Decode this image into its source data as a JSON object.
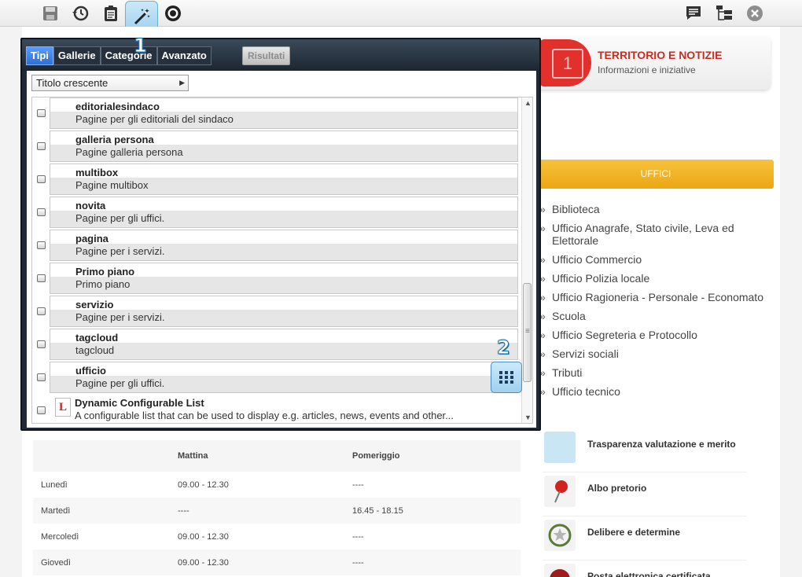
{
  "toolbar": {
    "left_icons": [
      "save-icon",
      "history-icon",
      "clipboard-icon",
      "magic-wand-icon",
      "target-icon"
    ],
    "right_icons": [
      "comment-icon",
      "tree-icon",
      "close-icon"
    ],
    "badge_1": "1",
    "badge_2": "2"
  },
  "dialog": {
    "tabs": [
      "Tipi",
      "Gallerie",
      "Categorie",
      "Avanzato"
    ],
    "active_tab": "Tipi",
    "results_label": "Risultati",
    "sort_label": "Titolo crescente",
    "items": [
      {
        "name": "editorialesindaco",
        "desc": "Pagine per gli editoriali del sindaco"
      },
      {
        "name": "galleria persona",
        "desc": "Pagine galleria persona"
      },
      {
        "name": "multibox",
        "desc": "Pagine multibox"
      },
      {
        "name": "novita",
        "desc": "Pagine per gli uffici."
      },
      {
        "name": "pagina",
        "desc": "Pagine per i servizi."
      },
      {
        "name": "Primo piano",
        "desc": "Primo piano"
      },
      {
        "name": "servizio",
        "desc": "Pagine per i servizi."
      },
      {
        "name": "tagcloud",
        "desc": "tagcloud"
      },
      {
        "name": "ufficio",
        "desc": "Pagine per gli uffici."
      },
      {
        "name": "Dynamic Configurable List",
        "desc": "A configurable list that can be used to display e.g. articles, news, events and other..."
      }
    ]
  },
  "site": {
    "promo": {
      "title": "TERRITORIO E NOTIZIE",
      "subtitle": "Informazioni e iniziative",
      "calendar_day": "1"
    },
    "uffici_title": "UFFICI",
    "uffici": [
      "Biblioteca",
      "Ufficio Anagrafe, Stato civile, Leva ed Elettorale",
      "Ufficio Commercio",
      "Ufficio Polizia locale",
      "Ufficio Ragioneria - Personale - Economato",
      "Scuola",
      "Ufficio Segreteria e Protocollo",
      "Servizi sociali",
      "Tributi",
      "Ufficio tecnico"
    ],
    "side_links": [
      "Trasparenza valutazione e merito",
      "Albo pretorio",
      "Delibere e determine",
      "Posta elettronica certificata"
    ],
    "orari": {
      "headers": [
        "",
        "Mattina",
        "Pomeriggio"
      ],
      "rows": [
        [
          "Lunedì",
          "09.00 - 12.30",
          "----"
        ],
        [
          "Martedì",
          "----",
          "16.45 - 18.15"
        ],
        [
          "Mercoledì",
          "09.00 - 12.30",
          "----"
        ],
        [
          "Giovedì",
          "09.00 - 12.30",
          "----"
        ]
      ]
    }
  }
}
